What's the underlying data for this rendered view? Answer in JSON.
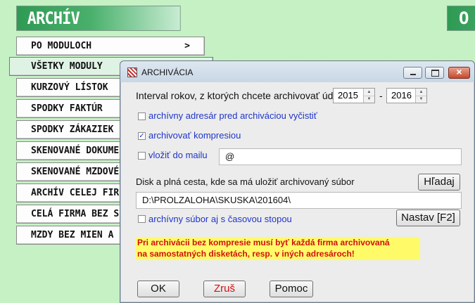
{
  "banner": {
    "title": "ARCHÍV",
    "right_partial": "O"
  },
  "menu": {
    "items": [
      {
        "label": "PO MODULOCH",
        "arrow": ">"
      },
      {
        "label": "VŠETKY MODULY"
      },
      {
        "label": "KURZOVÝ LÍSTOK"
      },
      {
        "label": "SPODKY FAKTÚR"
      },
      {
        "label": "SPODKY ZÁKAZIEK"
      },
      {
        "label": "SKENOVANÉ DOKUME"
      },
      {
        "label": "SKENOVANÉ MZDOVÉ"
      },
      {
        "label": "ARCHÍV CELEJ FIR"
      },
      {
        "label": "CELÁ FIRMA BEZ S"
      },
      {
        "label": "MZDY BEZ MIEN A"
      }
    ]
  },
  "dialog": {
    "title": "ARCHIVÁCIA",
    "window_controls": {
      "close": "×"
    },
    "interval": {
      "label": "Interval rokov, z ktorých chcete archivovať údaje",
      "from": "2015",
      "separator": "-",
      "to": "2016"
    },
    "options": {
      "clear_addressbook": {
        "label": "archívny adresár pred archiváciou vyčistiť",
        "checked": false
      },
      "compression": {
        "label": "archivovať kompresiou",
        "checked": true,
        "mark": "✓"
      },
      "mail": {
        "label": "vložiť do mailu",
        "checked": false,
        "value": "@"
      },
      "timestamp": {
        "label": "archívny súbor aj s časovou stopou",
        "checked": false
      }
    },
    "path": {
      "label": "Disk a plná cesta, kde sa má uložiť archivovaný súbor",
      "value": "D:\\PROLZALOHA\\SKUSKA\\201604\\"
    },
    "buttons": {
      "search": "Hľadaj",
      "settings": "Nastav [F2]",
      "ok": "OK",
      "cancel": "Zruš",
      "help": "Pomoc"
    },
    "warning": {
      "line1": "Pri archivácii bez kompresie musí byť každá firma archivovaná",
      "line2": "na samostatných disketách, resp. v iných adresároch!"
    }
  }
}
